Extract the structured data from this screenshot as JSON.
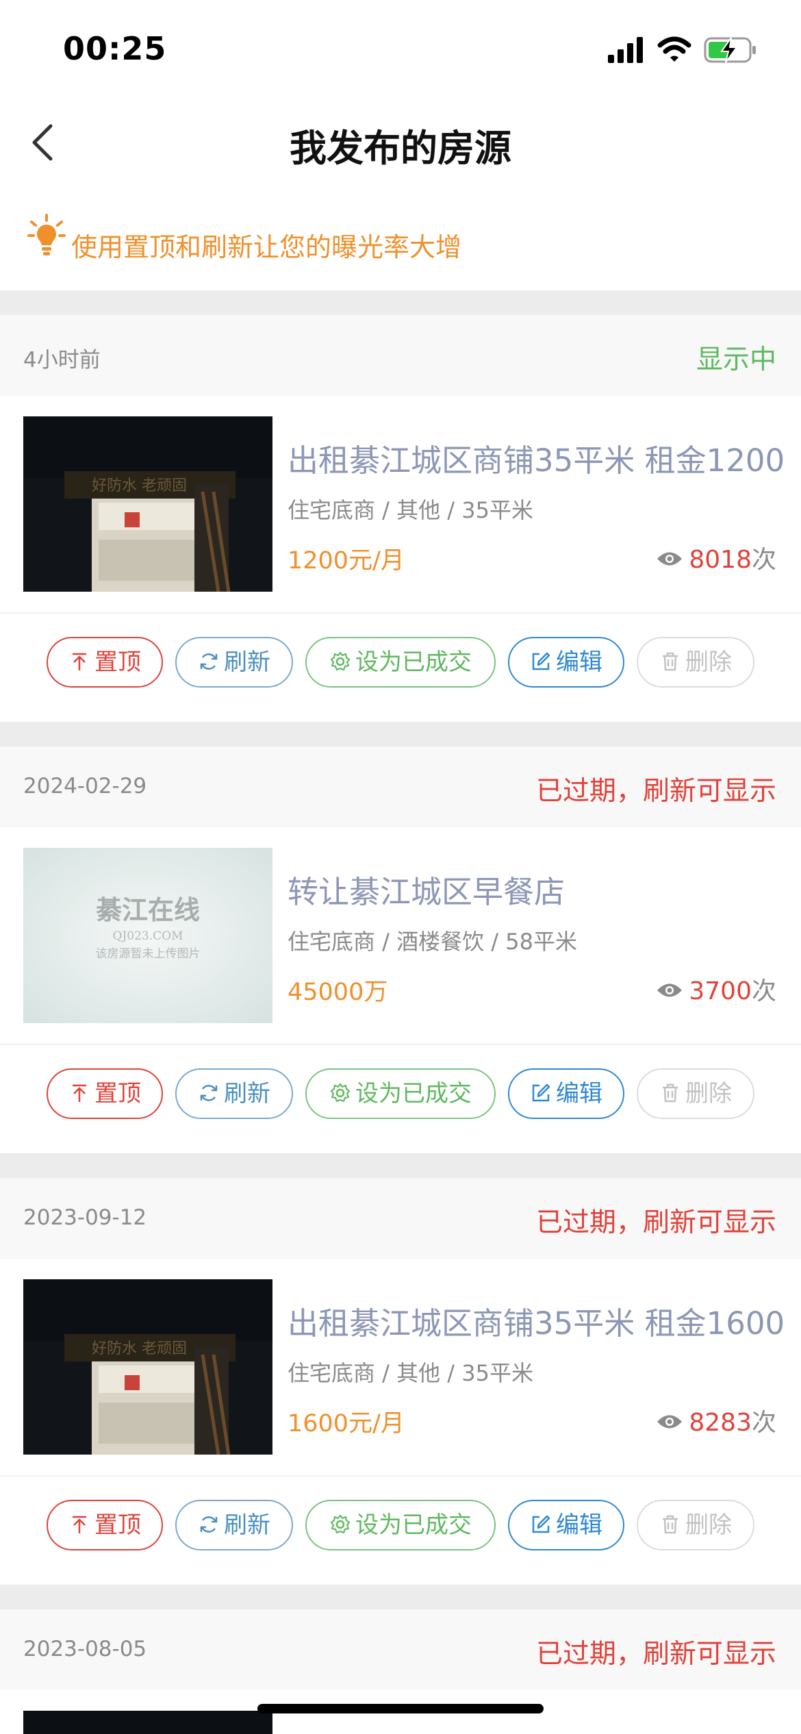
{
  "status_bar": {
    "time": "00:25",
    "icons": [
      "signal-icon",
      "wifi-icon",
      "battery-charging-icon"
    ]
  },
  "nav": {
    "title": "我发布的房源",
    "back_icon": "chevron-left-icon"
  },
  "tip": {
    "icon": "lightbulb-icon",
    "text": "使用置顶和刷新让您的曝光率大增"
  },
  "colors": {
    "accent_orange": "#f0902b",
    "status_active": "#5fb95f",
    "status_expired": "#e0423a",
    "title_blue_gray": "#8c96b5",
    "edit_blue": "#2f88d2"
  },
  "actions": {
    "top": "置顶",
    "refresh": "刷新",
    "mark_done": "设为已成交",
    "edit": "编辑",
    "delete": "删除"
  },
  "views_unit": "次",
  "listings": [
    {
      "date": "4小时前",
      "status": "显示中",
      "title": "出租綦江城区商铺35平米 租金1200",
      "meta": "住宅底商 / 其他 / 35平米",
      "price": "1200元/月",
      "views": "8018",
      "image": "storefront-photo"
    },
    {
      "date": "2024-02-29",
      "status": "已过期，刷新可显示",
      "title": "转让綦江城区早餐店",
      "meta": "住宅底商 / 酒楼餐饮 / 58平米",
      "price": "45000万",
      "views": "3700",
      "image": "placeholder-logo",
      "placeholder": {
        "brand": "綦江在线",
        "domain": "QJ023.COM",
        "note": "该房源暂未上传图片"
      }
    },
    {
      "date": "2023-09-12",
      "status": "已过期，刷新可显示",
      "title": "出租綦江城区商铺35平米 租金1600",
      "meta": "住宅底商 / 其他 / 35平米",
      "price": "1600元/月",
      "views": "8283",
      "image": "storefront-photo"
    },
    {
      "date": "2023-08-05",
      "status": "已过期，刷新可显示"
    }
  ]
}
